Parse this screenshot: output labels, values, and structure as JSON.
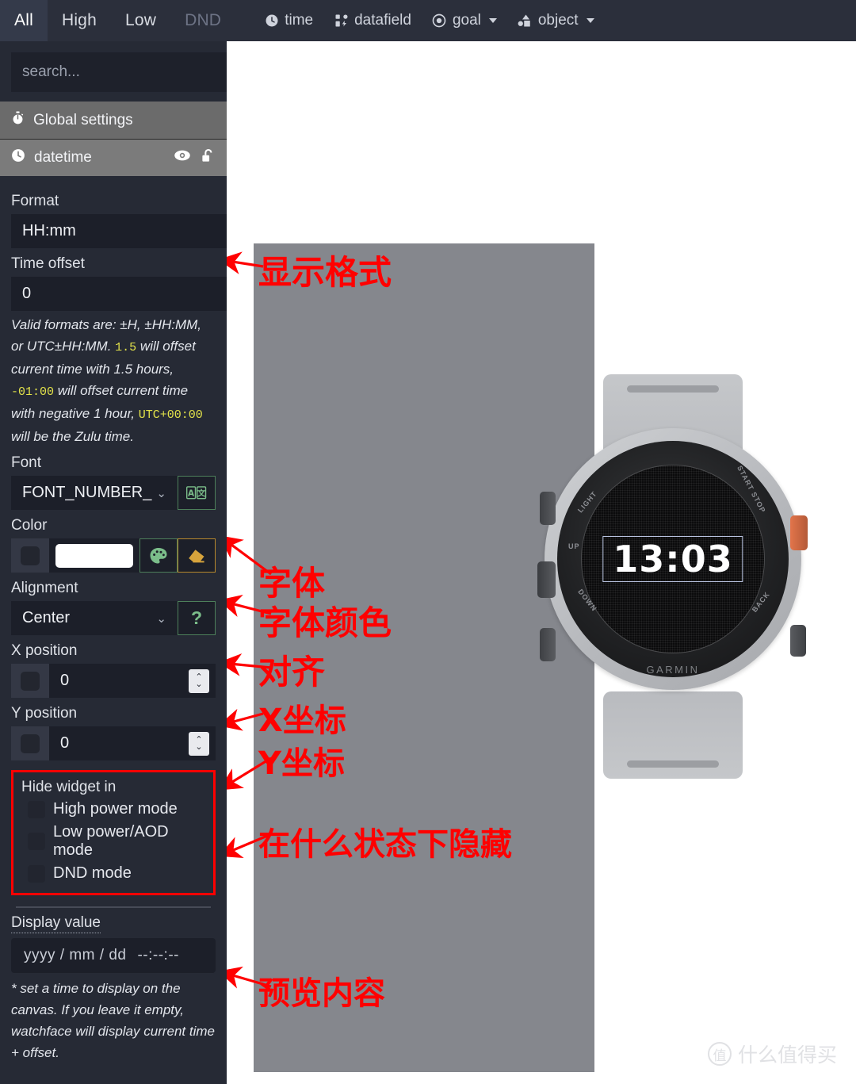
{
  "topbar": {
    "mode_tabs": [
      {
        "label": "All",
        "state": "active"
      },
      {
        "label": "High",
        "state": "normal"
      },
      {
        "label": "Low",
        "state": "normal"
      },
      {
        "label": "DND",
        "state": "dim"
      }
    ],
    "object_tools": [
      {
        "label": "time",
        "icon": "clock-icon",
        "has_caret": false
      },
      {
        "label": "datafield",
        "icon": "datafield-icon",
        "has_caret": false
      },
      {
        "label": "goal",
        "icon": "target-icon",
        "has_caret": true
      },
      {
        "label": "object",
        "icon": "shapes-icon",
        "has_caret": true
      }
    ]
  },
  "sidebar": {
    "search": {
      "placeholder": "search...",
      "value": ""
    },
    "collapse_icon": "chevron-left-icon",
    "panels": [
      {
        "label": "Global settings",
        "icon": "stopwatch-icon"
      },
      {
        "label": "datetime",
        "icon": "clock-icon",
        "right_icons": [
          "eye-icon",
          "unlock-icon"
        ]
      }
    ],
    "format": {
      "label": "Format",
      "value": "HH:mm",
      "help_label": "?"
    },
    "time_offset": {
      "label": "Time offset",
      "value": "0",
      "help_label": "?",
      "hint_line1": "Valid formats are: ±H, ±HH:MM,",
      "hint_line2": "or UTC±HH:MM.",
      "example1_code": "1.5",
      "example1_text": " will offset current time with 1.5 hours,",
      "example2_code": "-01:00",
      "example2_text": " will offset current time with negative 1 hour,",
      "example3_code": "UTC+00:00",
      "example3_text": " will be the Zulu time."
    },
    "font": {
      "label": "Font",
      "value": "FONT_NUMBER_",
      "button_icon": "translate-icon"
    },
    "color": {
      "label": "Color",
      "value_hex": "#ffffff",
      "palette_icon": "palette-icon",
      "eraser_icon": "eraser-icon"
    },
    "alignment": {
      "label": "Alignment",
      "value": "Center",
      "help_label": "?"
    },
    "x_position": {
      "label": "X position",
      "value": "0"
    },
    "y_position": {
      "label": "Y position",
      "value": "0"
    },
    "hide_widget": {
      "title": "Hide widget in",
      "options": [
        {
          "label": "High power mode",
          "checked": false
        },
        {
          "label": "Low power/AOD mode",
          "checked": false
        },
        {
          "label": "DND mode",
          "checked": false
        }
      ],
      "highlight_color": "#ff0000"
    },
    "display_value": {
      "label": "Display value",
      "date_placeholder": "yyyy / mm / dd",
      "time_placeholder": "--:--:--",
      "note": "* set a time to display on the canvas. If you leave it empty, watchface will display current time + offset."
    }
  },
  "canvas": {
    "watch": {
      "brand": "GARMIN",
      "time_display": "13:03",
      "button_labels": [
        "LIGHT",
        "UP",
        "DOWN",
        "START STOP",
        "BACK"
      ]
    },
    "annotations": [
      {
        "text": "显示格式",
        "target": "format-field"
      },
      {
        "text": "字体",
        "target": "font-field"
      },
      {
        "text": "字体颜色",
        "target": "color-field"
      },
      {
        "text": "对齐",
        "target": "alignment-field"
      },
      {
        "text": "X坐标",
        "target": "x-position-field"
      },
      {
        "text": "Y坐标",
        "target": "y-position-field"
      },
      {
        "text": "在什么状态下隐藏",
        "target": "hide-widget-box"
      },
      {
        "text": "预览内容",
        "target": "display-value-field"
      }
    ],
    "watermark": {
      "mark": "值",
      "text": "什么值得买"
    }
  }
}
